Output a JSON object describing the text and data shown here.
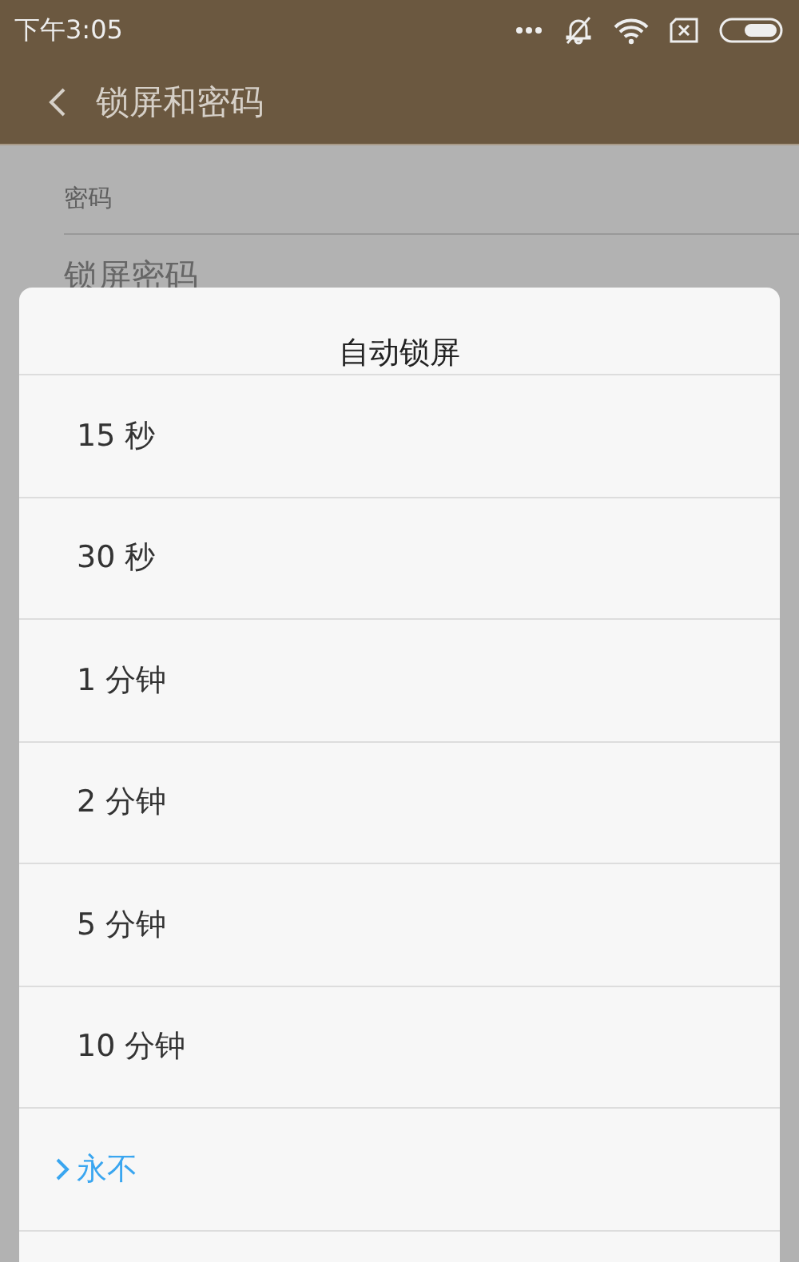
{
  "status_bar": {
    "time": "下午3:05"
  },
  "app_bar": {
    "title": "锁屏和密码"
  },
  "settings": {
    "section_header": "密码",
    "items": [
      "锁屏密码"
    ]
  },
  "dialog": {
    "title": "自动锁屏",
    "options": [
      {
        "label": "15 秒",
        "selected": false
      },
      {
        "label": "30 秒",
        "selected": false
      },
      {
        "label": "1 分钟",
        "selected": false
      },
      {
        "label": "2 分钟",
        "selected": false
      },
      {
        "label": "5 分钟",
        "selected": false
      },
      {
        "label": "10 分钟",
        "selected": false
      },
      {
        "label": "永不",
        "selected": true
      }
    ]
  }
}
